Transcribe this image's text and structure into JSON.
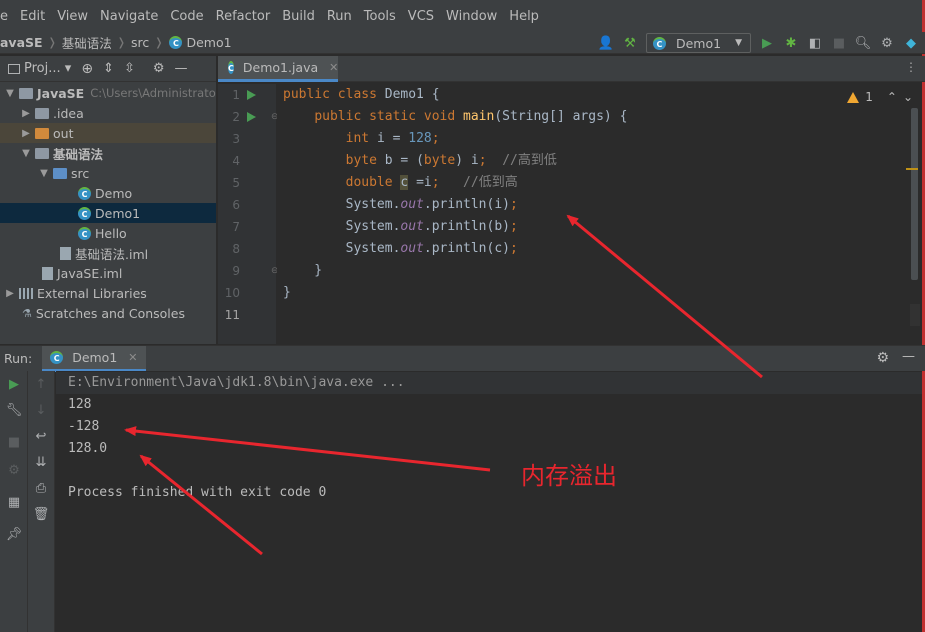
{
  "menu": [
    "e",
    "Edit",
    "View",
    "Navigate",
    "Code",
    "Refactor",
    "Build",
    "Run",
    "Tools",
    "VCS",
    "Window",
    "Help"
  ],
  "breadcrumb": {
    "project": "avaSE",
    "module": "基础语法",
    "folder": "src",
    "file": "Demo1"
  },
  "toolbar": {
    "run_config": "Demo1",
    "icons": [
      "user-icon",
      "hammer-icon",
      "run-icon",
      "debug-icon",
      "coverage-icon",
      "stop-icon",
      "search-icon",
      "gear-icon",
      "toolbox-icon"
    ]
  },
  "project_panel": {
    "title": "Proj...",
    "tree": [
      {
        "label": "JavaSE",
        "hint": "C:\\Users\\Administrato",
        "level": 0,
        "arrow": "down",
        "icon": "folder-gray"
      },
      {
        "label": ".idea",
        "level": 1,
        "arrow": "right",
        "icon": "folder-gray"
      },
      {
        "label": "out",
        "level": 1,
        "arrow": "right",
        "icon": "folder-orange"
      },
      {
        "label": "基础语法",
        "level": 1,
        "arrow": "down",
        "icon": "folder-gray"
      },
      {
        "label": "src",
        "level": 2,
        "arrow": "down",
        "icon": "folder-blue"
      },
      {
        "label": "Demo",
        "level": 3,
        "icon": "class"
      },
      {
        "label": "Demo1",
        "level": 3,
        "icon": "class",
        "selected": true
      },
      {
        "label": "Hello",
        "level": 3,
        "icon": "class"
      },
      {
        "label": "基础语法.iml",
        "level": 2,
        "icon": "file"
      },
      {
        "label": "JavaSE.iml",
        "level": 1,
        "icon": "file"
      },
      {
        "label": "External Libraries",
        "level": 0,
        "arrow": "right",
        "icon": "library"
      },
      {
        "label": "Scratches and Consoles",
        "level": 0,
        "icon": "scratch"
      }
    ]
  },
  "editor": {
    "tab": "Demo1.java",
    "inspection_count": "1",
    "line_numbers": [
      "1",
      "2",
      "3",
      "4",
      "5",
      "6",
      "7",
      "8",
      "9",
      "10",
      "11"
    ],
    "code": [
      "public class Demo1 {",
      "    public static void main(String[] args) {",
      "        int i = 128;",
      "        byte b = (byte) i;  //高到低",
      "        double c =i;   //低到高",
      "        System.out.println(i);",
      "        System.out.println(b);",
      "        System.out.println(c);",
      "    }",
      "}",
      ""
    ]
  },
  "run_panel": {
    "label": "Run:",
    "tab": "Demo1",
    "console": [
      "E:\\Environment\\Java\\jdk1.8\\bin\\java.exe ...",
      "128",
      "-128",
      "128.0",
      "",
      "Process finished with exit code 0"
    ]
  },
  "annotation": {
    "text": "内存溢出",
    "color": "#e8262e"
  }
}
